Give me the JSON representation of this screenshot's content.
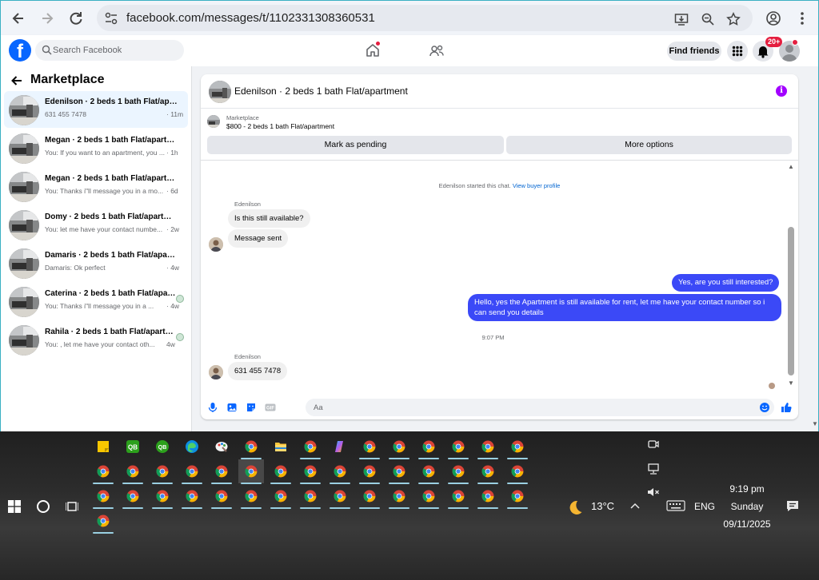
{
  "browser": {
    "url": "facebook.com/messages/t/1102331308360531"
  },
  "facebook": {
    "logo": "f",
    "search_placeholder": "Search Facebook",
    "find_friends": "Find friends",
    "notifications_badge": "20+"
  },
  "sidebar": {
    "title": "Marketplace",
    "conversations": [
      {
        "name": "Edenilson · 2 beds 1 bath Flat/apartment",
        "snippet": "631 455 7478",
        "time": "· 11m",
        "active": true,
        "seen": false
      },
      {
        "name": "Megan · 2 beds 1 bath Flat/apartment",
        "snippet": "You: If you want to an apartment, you ...",
        "time": "· 1h",
        "active": false,
        "seen": false
      },
      {
        "name": "Megan · 2 beds 1 bath Flat/apartment",
        "snippet": "You: Thanks i\"ll message you in a mo...",
        "time": "· 6d",
        "active": false,
        "seen": false
      },
      {
        "name": "Domy · 2 beds 1 bath Flat/apartment",
        "snippet": "You: let me have your contact numbe...",
        "time": "· 2w",
        "active": false,
        "seen": false
      },
      {
        "name": "Damaris · 2 beds 1 bath Flat/apartment",
        "snippet": "Damaris: Ok perfect",
        "time": "· 4w",
        "active": false,
        "seen": false
      },
      {
        "name": "Caterina · 2 beds 1 bath Flat/apartment",
        "snippet": "You: Thanks i\"ll message you in a ...",
        "time": "· 4w",
        "active": false,
        "seen": true
      },
      {
        "name": "Rahila · 2 beds 1 bath Flat/apartment",
        "snippet": "You: , let me have your contact oth...",
        "time": "4w",
        "active": false,
        "seen": true
      }
    ]
  },
  "chat": {
    "title": "Edenilson · 2 beds 1 bath Flat/apartment",
    "listing_source": "Marketplace",
    "listing_desc": "$800 - 2 beds 1 bath Flat/apartment",
    "mark_pending": "Mark as pending",
    "more_options": "More options",
    "system_text": "Edenilson started this chat.",
    "view_profile": "View buyer profile",
    "sender_1": "Edenilson",
    "msg_1": "Is this still available?",
    "msg_2": "Message sent",
    "out_1": "Yes, are you still interested?",
    "out_2": "Hello, yes the Apartment is still available for rent, let me have your contact number so i can send you details",
    "timestamp": "9:07 PM",
    "sender_2": "Edenilson",
    "msg_3": "631 455 7478",
    "composer_placeholder": "Aa"
  },
  "taskbar": {
    "temperature": "13°C",
    "language": "ENG",
    "time": "9:19 pm",
    "day": "Sunday",
    "date": "09/11/2025"
  },
  "colors": {
    "fb_blue": "#0866ff",
    "outgoing_bubble": "#3b49f7",
    "badge_red": "#e41e3f",
    "info_purple": "#a200ff"
  }
}
